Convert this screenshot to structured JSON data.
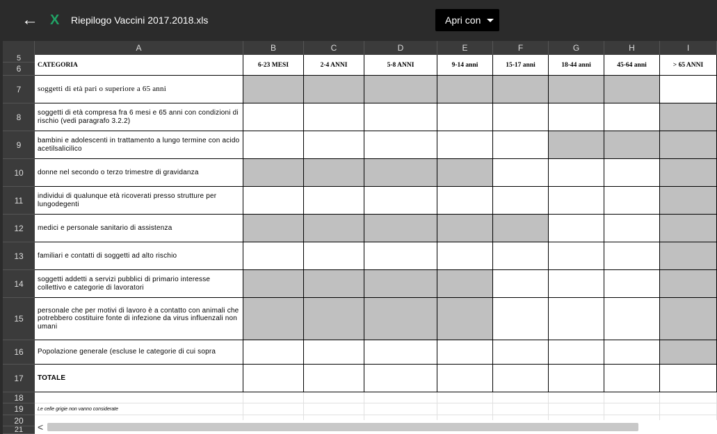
{
  "app": {
    "back_label": "←",
    "file_icon": "X",
    "file_name": "Riepilogo Vaccini 2017.2018.xls",
    "open_with_label": "Apri con"
  },
  "columns": [
    "A",
    "B",
    "C",
    "D",
    "E",
    "F",
    "G",
    "H",
    "I"
  ],
  "rows_numbers": [
    "5",
    "6",
    "7",
    "8",
    "9",
    "10",
    "11",
    "12",
    "13",
    "14",
    "15",
    "16",
    "17",
    "18",
    "19",
    "20",
    "21"
  ],
  "header": {
    "categoria": "CATEGORIA",
    "ages": [
      "6-23 MESI",
      "2-4 ANNI",
      "5-8 ANNI",
      "9-14 anni",
      "15-17 anni",
      "18-44 anni",
      "45-64 anni",
      "> 65 ANNI"
    ]
  },
  "categories": [
    {
      "row": "7",
      "text": "soggetti di età pari o superiore a 65 anni",
      "gray": [
        true,
        true,
        true,
        true,
        true,
        true,
        true,
        false
      ]
    },
    {
      "row": "8",
      "text": "soggetti di età compresa fra 6 mesi e 65 anni con condizioni di rischio (vedi paragrafo 3.2.2)",
      "gray": [
        false,
        false,
        false,
        false,
        false,
        false,
        false,
        true
      ]
    },
    {
      "row": "9",
      "text": "bambini e adolescenti in trattamento a lungo termine con acido acetilsalicilico",
      "gray": [
        false,
        false,
        false,
        false,
        false,
        true,
        true,
        true
      ]
    },
    {
      "row": "10",
      "text": "donne nel secondo o terzo trimestre di gravidanza",
      "gray": [
        true,
        true,
        true,
        true,
        false,
        false,
        false,
        true
      ]
    },
    {
      "row": "11",
      "text": "individui di qualunque età ricoverati presso strutture per lungodegenti",
      "gray": [
        false,
        false,
        false,
        false,
        false,
        false,
        false,
        true
      ]
    },
    {
      "row": "12",
      "text": "medici e personale sanitario di assistenza",
      "gray": [
        true,
        true,
        true,
        true,
        true,
        false,
        false,
        true
      ]
    },
    {
      "row": "13",
      "text": "familiari e contatti di soggetti ad alto rischio",
      "gray": [
        false,
        false,
        false,
        false,
        false,
        false,
        false,
        true
      ]
    },
    {
      "row": "14",
      "text": "soggetti addetti a servizi pubblici di primario interesse collettivo e categorie di lavoratori",
      "gray": [
        true,
        true,
        true,
        true,
        false,
        false,
        false,
        true
      ]
    },
    {
      "row": "15",
      "text": "personale che per motivi di lavoro è a contatto con animali che potrebbero costituire fonte di infezione da virus influenzali non umani",
      "gray": [
        true,
        true,
        true,
        true,
        false,
        false,
        false,
        true
      ]
    },
    {
      "row": "16",
      "text": "Popolazione generale (escluse le categorie di cui sopra",
      "gray": [
        false,
        false,
        false,
        false,
        false,
        false,
        false,
        true
      ]
    }
  ],
  "totale": "TOTALE",
  "note": "Le celle grigie non vanno considerate",
  "scroll_left": "<"
}
